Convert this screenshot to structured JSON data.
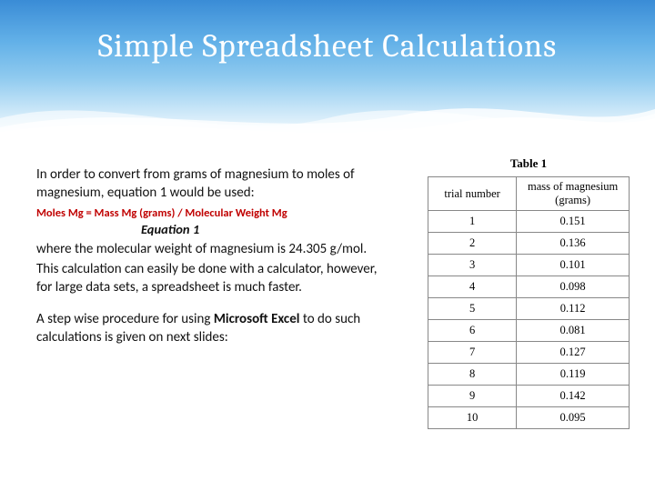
{
  "title": "Simple Spreadsheet Calculations",
  "body": {
    "intro": "In order to convert from grams of magnesium to moles of magnesium, equation 1 would be used:",
    "formula": "Moles Mg = Mass Mg (grams) / Molecular Weight Mg",
    "eq_label": "Equation 1",
    "where": "where the molecular weight of magnesium is 24.305 g/mol.",
    "calc": "This calculation can easily be done with a calculator, however, for large data sets, a spreadsheet is much faster.",
    "step_pre": "A step wise procedure for using ",
    "step_bold": "Microsoft Excel",
    "step_post": " to do such calculations is given on next slides:"
  },
  "table": {
    "caption": "Table 1",
    "headers": [
      "trial number",
      "mass of magnesium (grams)"
    ],
    "rows": [
      [
        "1",
        "0.151"
      ],
      [
        "2",
        "0.136"
      ],
      [
        "3",
        "0.101"
      ],
      [
        "4",
        "0.098"
      ],
      [
        "5",
        "0.112"
      ],
      [
        "6",
        "0.081"
      ],
      [
        "7",
        "0.127"
      ],
      [
        "8",
        "0.119"
      ],
      [
        "9",
        "0.142"
      ],
      [
        "10",
        "0.095"
      ]
    ]
  },
  "chart_data": {
    "type": "table",
    "title": "Table 1",
    "columns": [
      "trial number",
      "mass of magnesium (grams)"
    ],
    "rows": [
      [
        1,
        0.151
      ],
      [
        2,
        0.136
      ],
      [
        3,
        0.101
      ],
      [
        4,
        0.098
      ],
      [
        5,
        0.112
      ],
      [
        6,
        0.081
      ],
      [
        7,
        0.127
      ],
      [
        8,
        0.119
      ],
      [
        9,
        0.142
      ],
      [
        10,
        0.095
      ]
    ]
  }
}
